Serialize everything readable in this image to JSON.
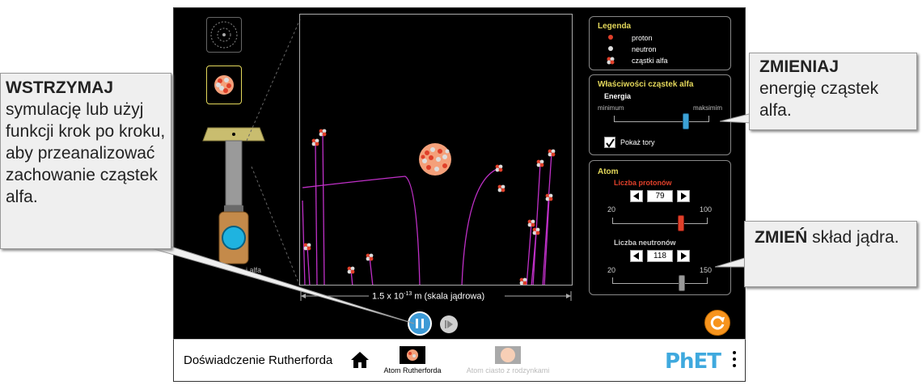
{
  "nav": {
    "title": "Doświadczenie Rutherforda",
    "screens": [
      {
        "label": "Atom Rutherforda",
        "active": true
      },
      {
        "label": "Atom ciasto z rodzynkami",
        "active": false
      }
    ],
    "brand": "PhET"
  },
  "legend": {
    "title": "Legenda",
    "items": [
      "proton",
      "neutron",
      "cząstki alfa"
    ]
  },
  "alpha_props": {
    "title": "Właściwości cząstek alfa",
    "energy_label": "Energia",
    "min_label": "minimum",
    "max_label": "maksimim",
    "energy_level": 0.75,
    "show_traces_label": "Pokaż tory",
    "show_traces_checked": true
  },
  "atom": {
    "title": "Atom",
    "protons_label": "Liczba protonów",
    "protons_value": "79",
    "protons_min": "20",
    "protons_max": "100",
    "neutrons_label": "Liczba neutronów",
    "neutrons_value": "118",
    "neutrons_min": "20",
    "neutrons_max": "150"
  },
  "scale": {
    "prefix": "1.5 x 10",
    "exponent": "-13",
    "suffix": " m (skala jądrowa)"
  },
  "gun_label": "i alfa",
  "callouts": {
    "pause_title": "WSTRZYMAJ",
    "pause_text": "symulację lub użyj funkcji krok po kroku, aby przeanalizować zachowanie cząstek alfa.",
    "energy_title": "ZMIENIAJ",
    "energy_text": "energię cząstek alfa.",
    "nucleus_title": "ZMIEŃ",
    "nucleus_text": " skład jądra."
  },
  "colors": {
    "panel_title": "#e4d85b",
    "protons_label": "#e0402a",
    "trace": "#c030c8",
    "accent_orange": "#f7941d",
    "phet_blue": "#3fa9de"
  }
}
